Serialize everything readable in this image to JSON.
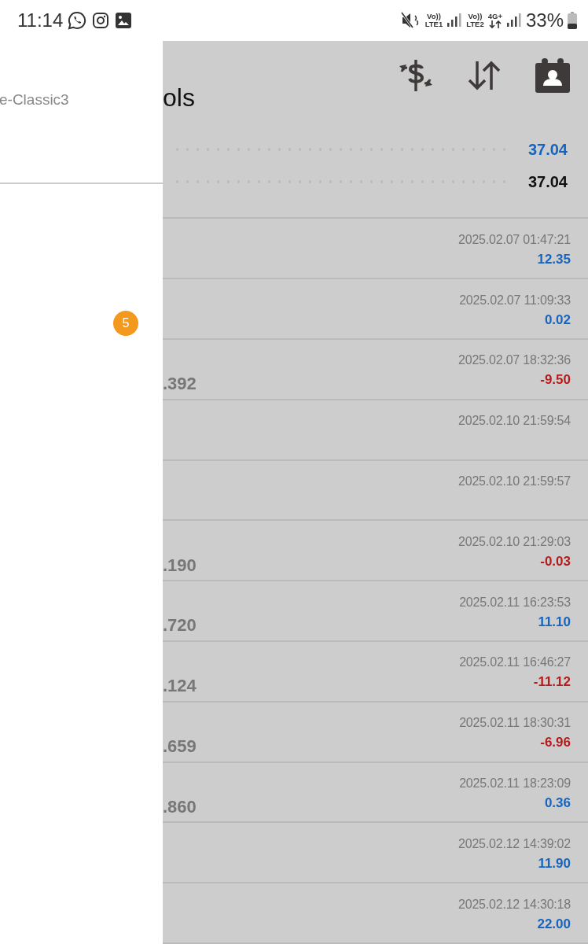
{
  "status_bar": {
    "time": "11:14",
    "volte1": {
      "top": "Vo))",
      "bottom": "LTE1"
    },
    "volte2": {
      "top": "Vo))",
      "bottom": "LTE2"
    },
    "network": "4G+",
    "battery": "33%"
  },
  "drawer": {
    "account": "e-Classic3",
    "badge": "5"
  },
  "header": {
    "title": "ols"
  },
  "summary": [
    {
      "value": "37.04",
      "color": "#1565c0"
    },
    {
      "value": "37.04",
      "color": "#111111"
    }
  ],
  "rows": [
    {
      "time": "2025.02.07 01:47:21",
      "profit": "12.35",
      "color": "#1565c0"
    },
    {
      "time": "2025.02.07 11:09:33",
      "profit": "0.02",
      "color": "#1565c0"
    },
    {
      "left": ".392",
      "time": "2025.02.07 18:32:36",
      "profit": "-9.50",
      "color": "#b71c1c"
    },
    {
      "time": "2025.02.10 21:59:54"
    },
    {
      "time": "2025.02.10 21:59:57"
    },
    {
      "left": ".190",
      "time": "2025.02.10 21:29:03",
      "profit": "-0.03",
      "color": "#b71c1c"
    },
    {
      "left": ".720",
      "time": "2025.02.11 16:23:53",
      "profit": "11.10",
      "color": "#1565c0"
    },
    {
      "left": ".124",
      "time": "2025.02.11 16:46:27",
      "profit": "-11.12",
      "color": "#b71c1c"
    },
    {
      "left": ".659",
      "time": "2025.02.11 18:30:31",
      "profit": "-6.96",
      "color": "#b71c1c"
    },
    {
      "left": ".860",
      "time": "2025.02.11 18:23:09",
      "profit": "0.36",
      "color": "#1565c0"
    },
    {
      "time": "2025.02.12 14:39:02",
      "profit": "11.90",
      "color": "#1565c0"
    },
    {
      "time": "2025.02.12 14:30:18",
      "profit": "22.00",
      "color": "#1565c0"
    }
  ]
}
